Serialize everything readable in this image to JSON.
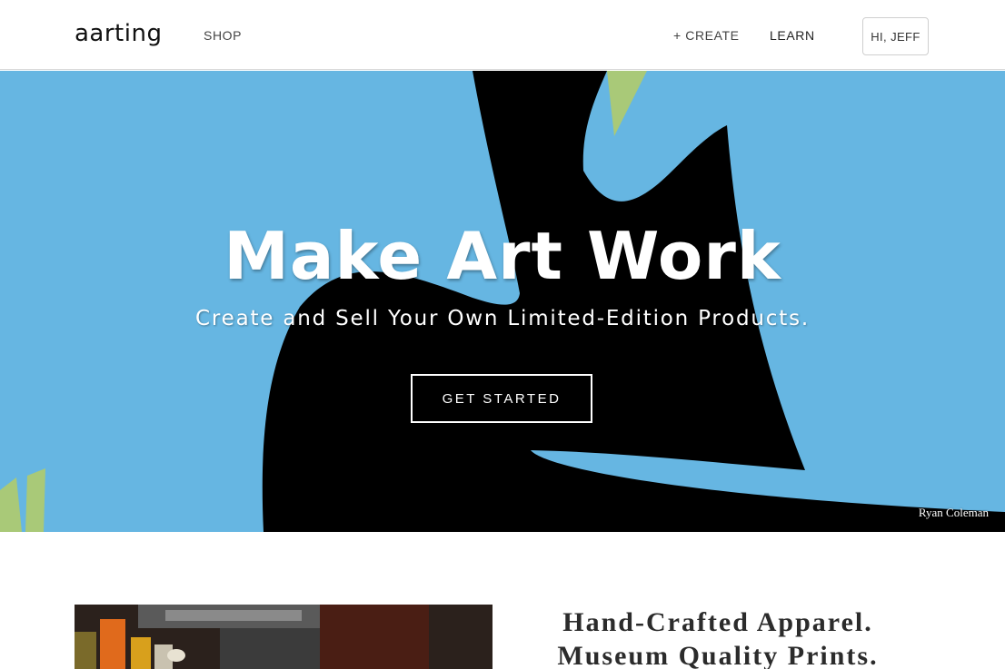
{
  "header": {
    "logo": "aarting",
    "nav": {
      "shop": "SHOP",
      "create": "+ CREATE",
      "learn": "LEARN"
    },
    "user_button": "HI, JEFF"
  },
  "hero": {
    "title": "Make Art Work",
    "subtitle": "Create and Sell Your Own Limited-Edition Products.",
    "cta": "GET STARTED",
    "credit": "Ryan Coleman",
    "colors": {
      "background": "#66b6e2",
      "shape": "#000000",
      "accent": "#a9c978"
    }
  },
  "feature": {
    "headline_lines": [
      "Hand-Crafted Apparel.",
      "Museum Quality Prints."
    ]
  }
}
